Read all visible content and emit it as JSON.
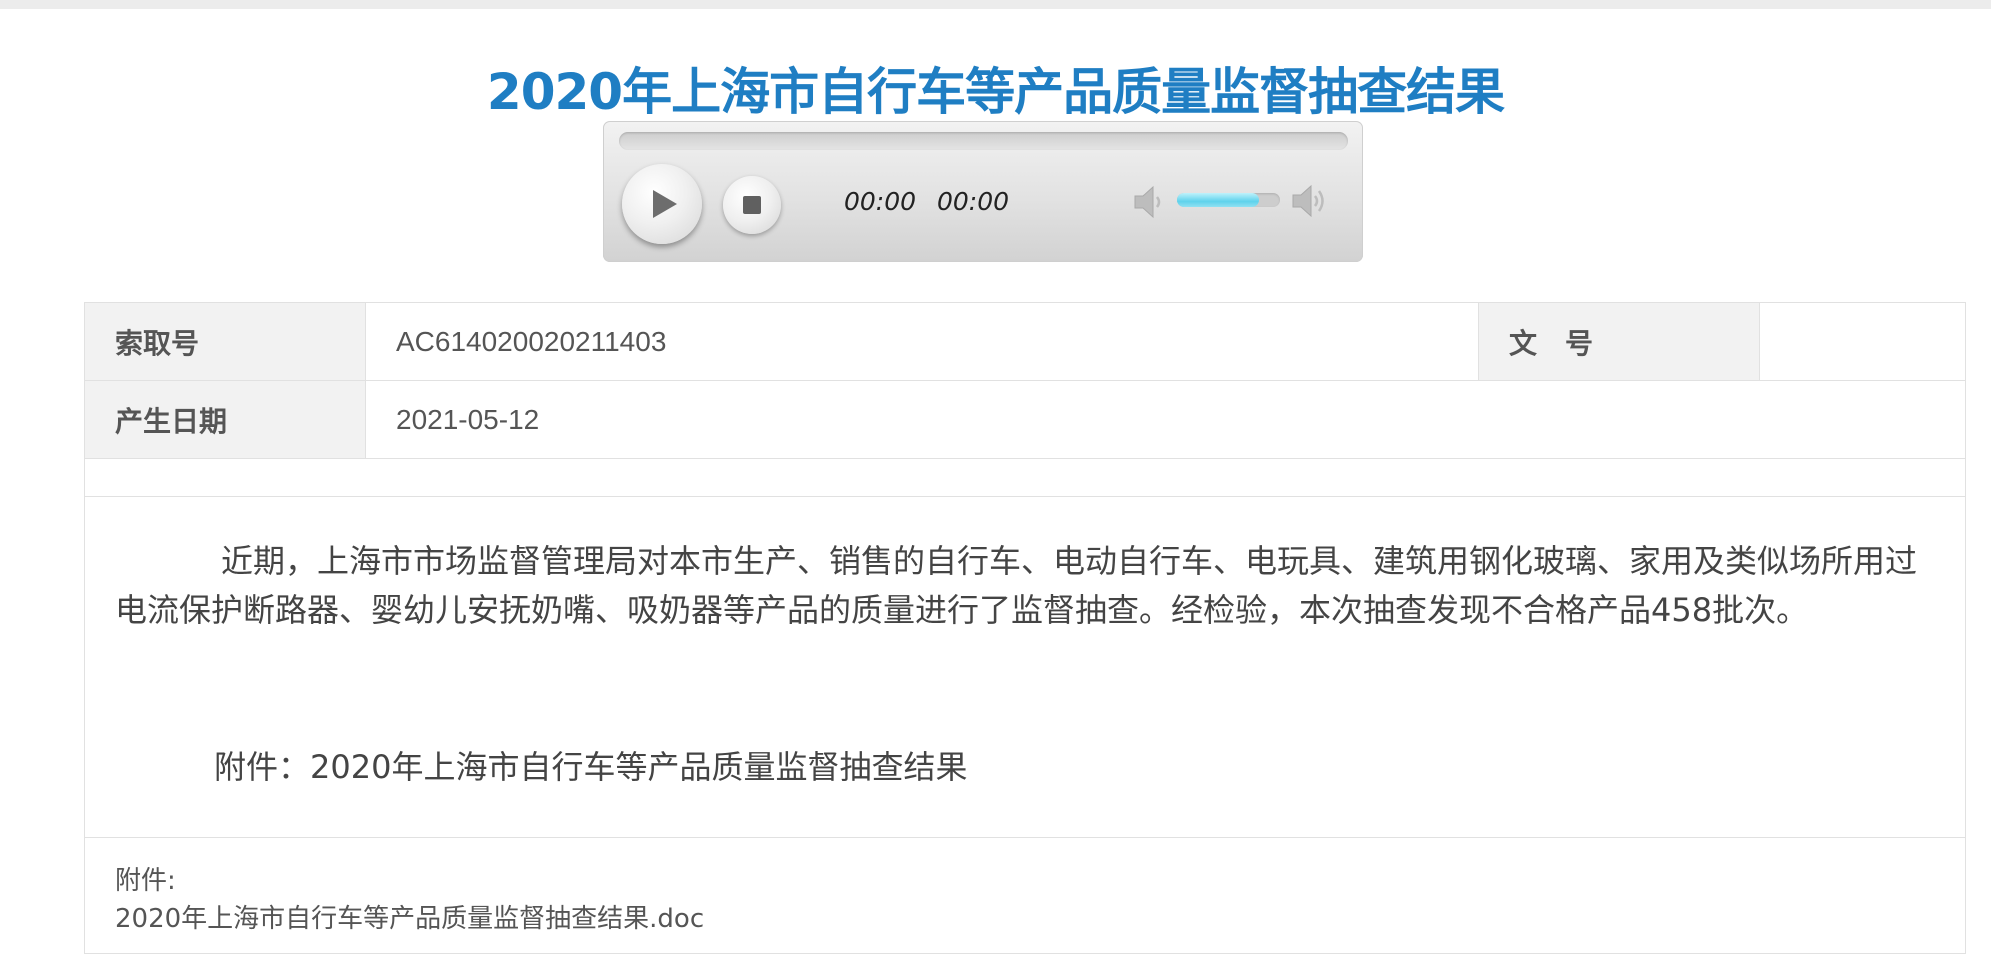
{
  "page": {
    "title": "2020年上海市自行车等产品质量监督抽查结果"
  },
  "player": {
    "current_time": "00:00",
    "duration": "00:00",
    "volume_fraction": 0.8,
    "icons": {
      "play": "play-icon",
      "stop": "stop-icon",
      "volume_low": "volume-low-icon",
      "volume_high": "volume-high-icon"
    }
  },
  "info": {
    "index_label": "索取号",
    "index_value": "AC614020020211403",
    "doc_no_label": "文　号",
    "doc_no_value": "",
    "date_label": "产生日期",
    "date_value": "2021-05-12"
  },
  "content": {
    "paragraph": "近期，上海市市场监督管理局对本市生产、销售的自行车、电动自行车、电玩具、建筑用钢化玻璃、家用及类似场所用过电流保护断路器、婴幼儿安抚奶嘴、吸奶器等产品的质量进行了监督抽查。经检验，本次抽查发现不合格产品458批次。",
    "attachment_line": "附件：2020年上海市自行车等产品质量监督抽查结果"
  },
  "attachments": {
    "label": "附件:",
    "file_name": "2020年上海市自行车等产品质量监督抽查结果.doc"
  },
  "colors": {
    "title": "#1f7ec3",
    "label_bg": "#f2f2f2",
    "border": "#e1e1e1",
    "volume_fill": "#5fd2ec"
  }
}
